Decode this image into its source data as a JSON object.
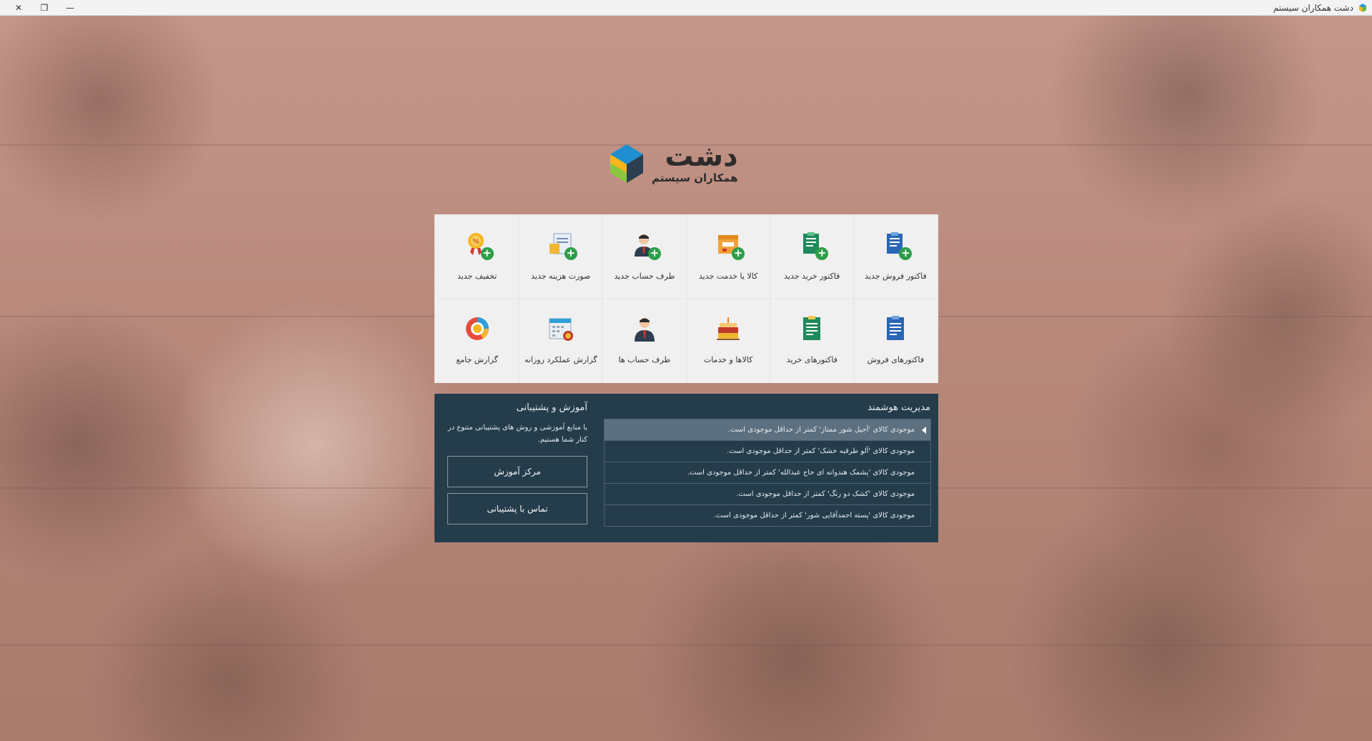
{
  "window": {
    "title": "دشت همکاران سیستم",
    "controls": {
      "close": "✕",
      "restore": "❐",
      "minimize": "—"
    }
  },
  "logo": {
    "main": "دشت",
    "sub": "همکاران سیستم"
  },
  "tiles": [
    {
      "label": "فاکتور فروش جدید",
      "icon": "sales-invoice-add-icon"
    },
    {
      "label": "فاکتور خرید جدید",
      "icon": "purchase-invoice-add-icon"
    },
    {
      "label": "کالا یا خدمت جدید",
      "icon": "product-add-icon"
    },
    {
      "label": "طرف حساب جدید",
      "icon": "person-add-icon"
    },
    {
      "label": "صورت هزینه جدید",
      "icon": "expense-add-icon"
    },
    {
      "label": "تخفیف جدید",
      "icon": "discount-add-icon"
    },
    {
      "label": "فاکتورهای فروش",
      "icon": "sales-invoices-icon"
    },
    {
      "label": "فاکتورهای خرید",
      "icon": "purchase-invoices-icon"
    },
    {
      "label": "کالاها و خدمات",
      "icon": "products-icon"
    },
    {
      "label": "طرف حساب ها",
      "icon": "persons-icon"
    },
    {
      "label": "گزارش عملکرد روزانه",
      "icon": "daily-report-icon"
    },
    {
      "label": "گزارش جامع",
      "icon": "general-report-icon"
    }
  ],
  "smart_management": {
    "title": "مدیریت هوشمند",
    "alerts": [
      "موجودی کالای  'آجیل شور ممتاز'  کمتر از حداقل موجودی است.",
      "موجودی کالای  'آلو طرقبه خشک'  کمتر از حداقل موجودی است.",
      "موجودی کالای  'پشمک هندوانه ای حاج عبدالله'  کمتر از حداقل موجودی است.",
      "موجودی کالای  'کشک دو رنگ'  کمتر از حداقل موجودی است.",
      "موجودی کالای  'پسته احمدآقایی شور'  کمتر از حداقل موجودی است."
    ]
  },
  "support": {
    "title": "آموزش و  پشتیبانی",
    "description": "با منابع آموزشی و روش های پشتیبانی متنوع در کنار شما هستیم.",
    "training_button": "مرکز آموزش",
    "contact_button": "تماس با پشتیبانی"
  },
  "colors": {
    "panel": "#253c4b",
    "tile_bg": "#f0f0f0",
    "accent_green": "#2e9d4a"
  }
}
